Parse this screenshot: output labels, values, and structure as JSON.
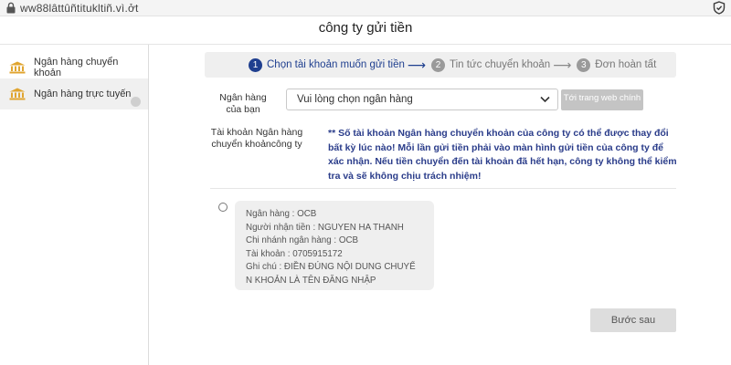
{
  "browser": {
    "url": "ww88lâttûñtitukltiñ.vì.ởt",
    "lock_icon": "lock-icon",
    "shield_icon": "shield-icon"
  },
  "page": {
    "title": "công ty gửi tiền"
  },
  "sidebar": {
    "items": [
      {
        "label": "Ngân hàng chuyển khoản",
        "icon": "bank-icon",
        "selected": false
      },
      {
        "label": "Ngân hàng trực tuyến",
        "icon": "bank-icon",
        "selected": true
      }
    ]
  },
  "steps": [
    {
      "number": "1",
      "label": "Chọn tài khoản muốn gửi tiền",
      "active": true
    },
    {
      "number": "2",
      "label": "Tin tức chuyển khoản",
      "active": false
    },
    {
      "number": "3",
      "label": "Đơn hoàn tất",
      "active": false
    }
  ],
  "form": {
    "bank_label_line1": "Ngân hàng",
    "bank_label_line2": "của bạn",
    "bank_select_value": "Vui lòng chọn ngân hàng",
    "web_button": "Tới trang web chính",
    "account_label_line1": "Tài khoản Ngân hàng",
    "account_label_line2": "chuyển khoảncông ty",
    "notice": "** Số tài khoản Ngân hàng chuyển khoản của công ty có thể được thay đổi bất kỳ lúc nào! Mỗi lần gửi tiền phải vào màn hình gửi tiền của công ty để xác nhận. Nếu tiền chuyển đến tài khoản đã hết hạn, công ty không thể kiểm tra và sẽ không chịu trách nhiệm!"
  },
  "account_card": {
    "bank": "Ngân hàng : OCB",
    "recipient": "Người nhận tiền : NGUYEN HA THANH",
    "branch": "Chi nhánh ngân hàng : OCB",
    "account": "Tài khoản : 0705915172",
    "note_line1": "Ghi chú : ĐIỀN ĐÚNG NỘI DUNG CHUYỂ",
    "note_line2": "N KHOẢN LÀ TÊN ĐĂNG NHẬP"
  },
  "actions": {
    "next": "Bước sau"
  },
  "colors": {
    "accent": "#1f3f8f",
    "notice_text": "#2a3c8a",
    "bank_icon": "#e0a530"
  }
}
